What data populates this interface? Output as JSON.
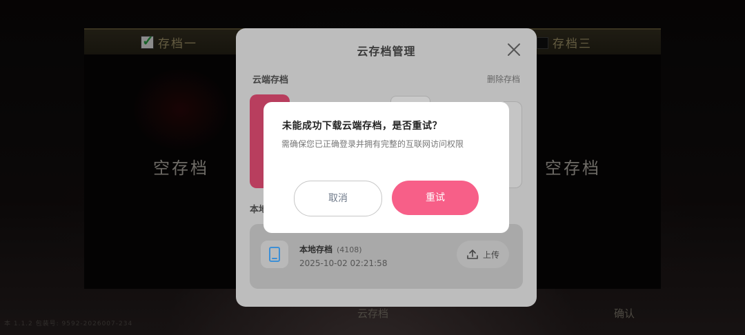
{
  "background": {
    "slot_tabs": [
      "存档一",
      "存档三"
    ],
    "empty_slot_label": "空存档",
    "bottom": {
      "cloud_label": "云存档",
      "confirm_label": "确认"
    },
    "version_text": "本 1.1.2  包装号: 9592-2026007-234"
  },
  "cloud_dialog": {
    "title": "云存档管理",
    "cloud_section_label": "云端存档",
    "delete_label": "删除存档",
    "local_section_label": "本地",
    "local_save": {
      "title": "本地存档",
      "count": "(4108)",
      "timestamp": "2025-10-02 02:21:58",
      "upload_label": "上传"
    }
  },
  "modal": {
    "title": "未能成功下载云端存档，是否重试？",
    "description": "需确保您已正确登录并拥有完整的互联网访问权限",
    "cancel_label": "取消",
    "retry_label": "重试"
  },
  "colors": {
    "accent": "#f75f88",
    "cancel_text": "#6f7a8a",
    "checkmark": "#2bb14a",
    "tab_gold": "#b6a877"
  },
  "icons": [
    "checkmark-icon",
    "close-icon",
    "tablet-icon",
    "upload-icon"
  ]
}
